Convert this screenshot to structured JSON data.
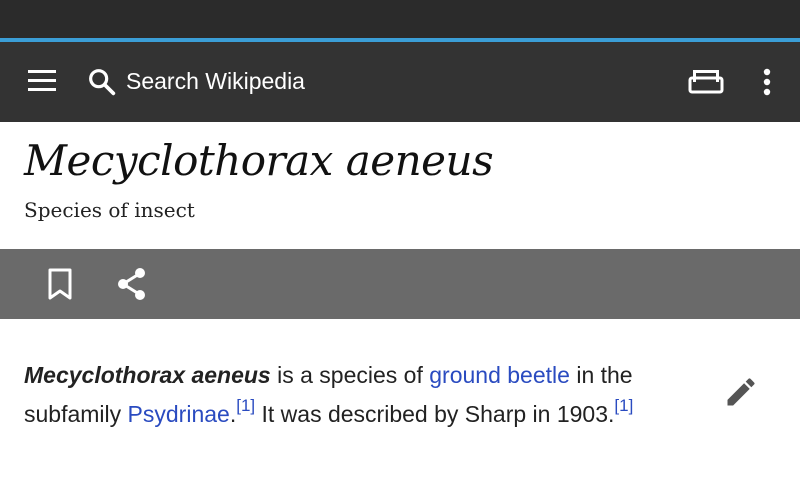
{
  "toolbar": {
    "search_placeholder": "Search Wikipedia",
    "icons": [
      "menu-icon",
      "search-icon",
      "tabs-icon",
      "overflow-menu-icon"
    ]
  },
  "page": {
    "title": "Mecyclothorax aeneus",
    "description": "Species of insect"
  },
  "actions": {
    "icons": [
      "bookmark-icon",
      "share-icon"
    ]
  },
  "article": {
    "subject": "Mecyclothorax aeneus",
    "text_1": " is a species of ",
    "link_1": "ground beetle",
    "text_2": " in the subfamily ",
    "link_2": "Psydrinae",
    "text_3": ".",
    "ref_1": "[1]",
    "text_4": " It was described by Sharp in 1903.",
    "ref_2": "[1]",
    "edit_icon": "pencil-icon"
  },
  "colors": {
    "toolbar": "#333333",
    "status_bar": "#2b2b2b",
    "progress": "#3b9ed6",
    "action_bar": "#6a6a6a",
    "link": "#2a4bc0"
  }
}
